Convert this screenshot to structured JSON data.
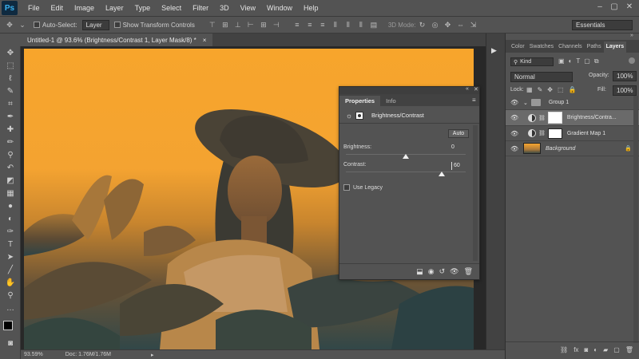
{
  "app": {
    "logo": "Ps",
    "menus": [
      "File",
      "Edit",
      "Image",
      "Layer",
      "Type",
      "Select",
      "Filter",
      "3D",
      "View",
      "Window",
      "Help"
    ],
    "window_controls": [
      "–",
      "▢",
      "✕"
    ]
  },
  "options_bar": {
    "auto_select_label": "Auto-Select:",
    "auto_select_target": "Layer",
    "show_transform_label": "Show Transform Controls",
    "mode_3d_label": "3D Mode:",
    "workspace": "Essentials"
  },
  "document": {
    "tab_title": "Untitled-1 @ 93.6% (Brightness/Contrast 1, Layer Mask/8) *",
    "close": "×"
  },
  "status_bar": {
    "zoom": "93.59%",
    "doc_info": "Doc: 1.76M/1.76M",
    "arrow": "▸"
  },
  "properties": {
    "tabs": [
      "Properties",
      "Info"
    ],
    "active_tab": "Properties",
    "title": "Brightness/Contrast",
    "auto_label": "Auto",
    "brightness_label": "Brightness:",
    "brightness_value": "0",
    "contrast_label": "Contrast:",
    "contrast_value": "60",
    "brightness_pos": 0.5,
    "contrast_pos": 0.8,
    "use_legacy_label": "Use Legacy",
    "menu_glyph": "≡",
    "collapse_glyph": "«",
    "close_glyph": "✕"
  },
  "layers_panel": {
    "tabs": [
      "Color",
      "Swatches",
      "Channels",
      "Paths",
      "Layers"
    ],
    "active_tab": "Layers",
    "filter_kind": "Kind",
    "blend_mode": "Normal",
    "opacity_label": "Opacity:",
    "opacity_value": "100%",
    "lock_label": "Lock:",
    "fill_label": "Fill:",
    "fill_value": "100%",
    "layers": [
      {
        "name": "Group 1",
        "type": "group"
      },
      {
        "name": "Brightness/Contra...",
        "type": "adjustment",
        "selected": true
      },
      {
        "name": "Gradient Map 1",
        "type": "adjustment"
      },
      {
        "name": "Background",
        "type": "image",
        "locked": true
      }
    ]
  },
  "colors": {
    "ui_bg": "#535353",
    "canvas_tint": "#f5a430",
    "selected_layer": "#6a6a6a"
  }
}
